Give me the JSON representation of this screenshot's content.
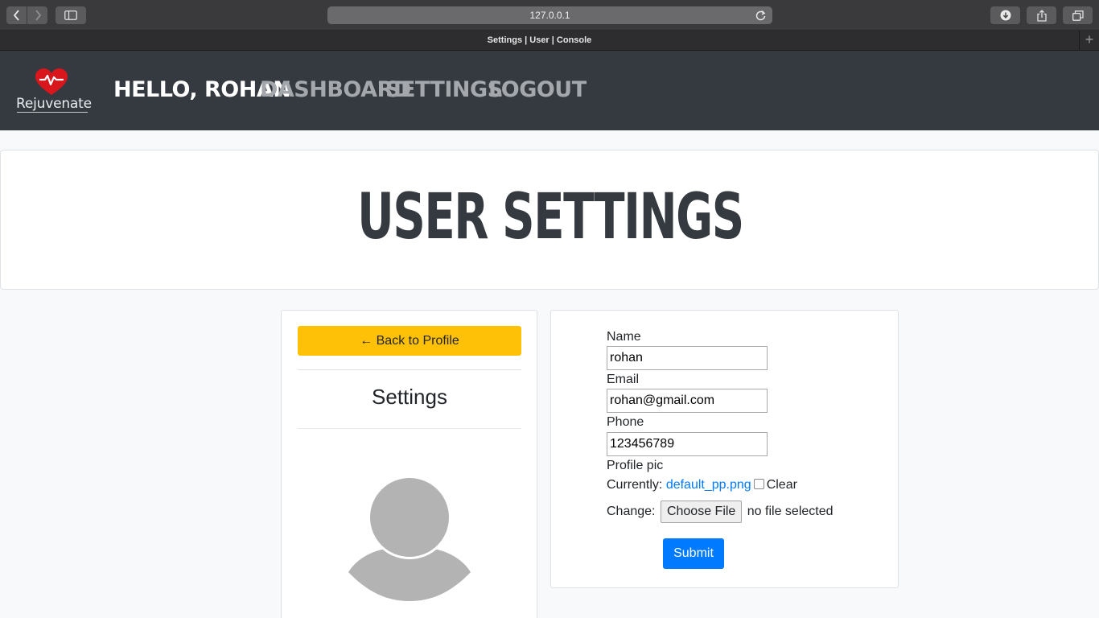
{
  "browser": {
    "url": "127.0.0.1",
    "tab_title": "Settings | User | Console",
    "new_tab_label": "+"
  },
  "navbar": {
    "logo_text": "Rejuvenate",
    "greeting": "HELLO, ROHAN",
    "links": [
      "DASHBOARD",
      "SETTINGS",
      "LOGOUT"
    ]
  },
  "header": {
    "title": "USER SETTINGS"
  },
  "sidebar": {
    "back_button": "← Back to Profile",
    "heading": "Settings"
  },
  "form": {
    "name_label": "Name",
    "name_value": "rohan",
    "email_label": "Email",
    "email_value": "rohan@gmail.com",
    "phone_label": "Phone",
    "phone_value": "123456789",
    "profile_pic_label": "Profile pic",
    "currently_label": "Currently:",
    "current_file": "default_pp.png",
    "clear_label": "Clear",
    "change_label": "Change:",
    "choose_file_label": "Choose File",
    "no_file_text": "no file selected",
    "submit_label": "Submit"
  },
  "colors": {
    "navbar_bg": "#343a40",
    "warning": "#ffc107",
    "primary": "#007bff"
  }
}
